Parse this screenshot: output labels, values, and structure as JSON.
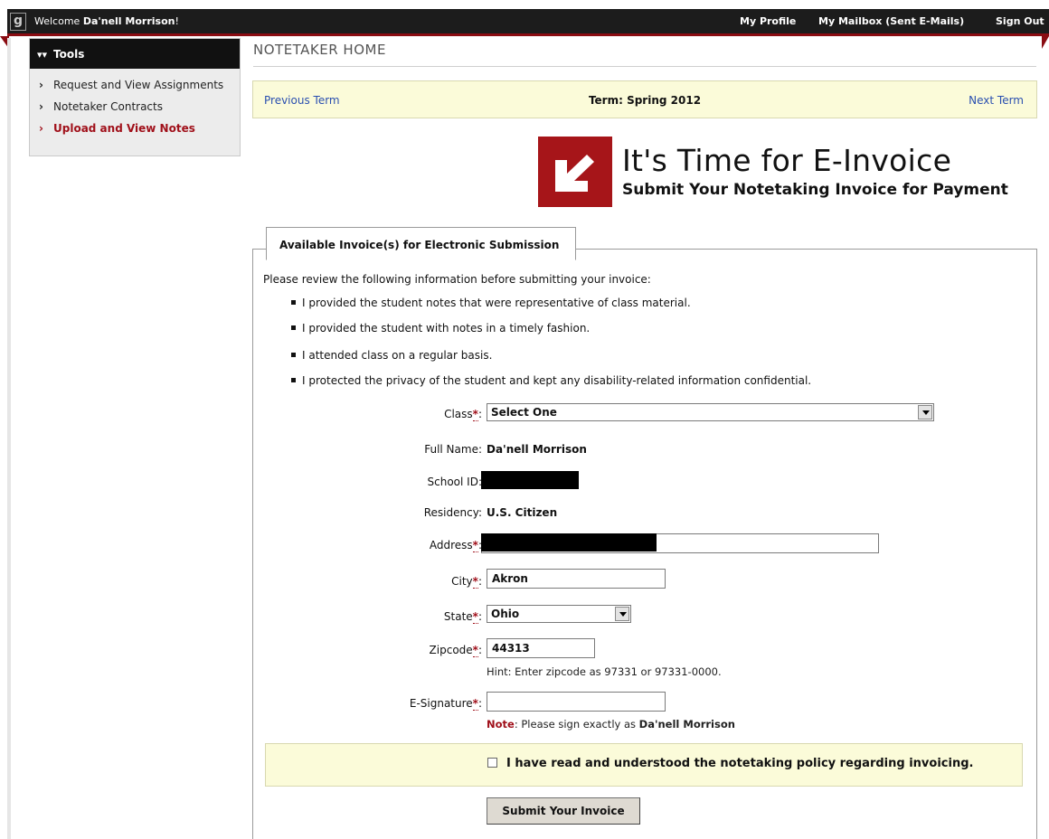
{
  "topbar": {
    "logo": "g",
    "welcome_prefix": "Welcome ",
    "user_name": "Da'nell Morrison",
    "welcome_suffix": "!",
    "links": [
      "My Profile",
      "My Mailbox (Sent E-Mails)",
      "Sign Out"
    ]
  },
  "sidebar": {
    "title": "Tools",
    "items": [
      {
        "label": "Request and View Assignments",
        "active": false
      },
      {
        "label": "Notetaker Contracts",
        "active": false
      },
      {
        "label": "Upload and View Notes",
        "active": true
      }
    ]
  },
  "page_title": "NOTETAKER HOME",
  "term_bar": {
    "previous": "Previous Term",
    "term": "Term: Spring 2012",
    "next": "Next Term"
  },
  "banner": {
    "title": "It's Time for E-Invoice",
    "subtitle": "Submit Your Notetaking Invoice for Payment",
    "icon": "arrow-down-left-icon",
    "color": "#a61519"
  },
  "panel": {
    "tab_label": "Available Invoice(s) for Electronic Submission",
    "intro": "Please review the following information before submitting your invoice:",
    "bullets": [
      "I provided the student notes that were representative of class material.",
      "I provided the student with notes in a timely fashion.",
      "I attended class on a regular basis.",
      "I protected the privacy of the student and kept any disability-related information confidential."
    ]
  },
  "form": {
    "class_label": "Class",
    "class_value": "Select One",
    "fullname_label": "Full Name:",
    "fullname_value": "Da'nell Morrison",
    "schoolid_label": "School ID:",
    "residency_label": "Residency:",
    "residency_value": "U.S. Citizen",
    "address_label": "Address",
    "city_label": "City",
    "city_value": "Akron",
    "state_label": "State",
    "state_value": "Ohio",
    "zip_label": "Zipcode",
    "zip_value": "44313",
    "zip_hint": "Hint: Enter zipcode as 97331 or 97331-0000.",
    "esig_label": "E-Signature",
    "esig_value": "",
    "note_word": "Note",
    "note_text": ": Please sign exactly as ",
    "note_name": "Da'nell Morrison",
    "required_mark": "*",
    "colon": ":"
  },
  "agreement": {
    "checked": false,
    "text": "I have read and understood the notetaking policy regarding invoicing."
  },
  "submit_label": "Submit Your Invoice"
}
